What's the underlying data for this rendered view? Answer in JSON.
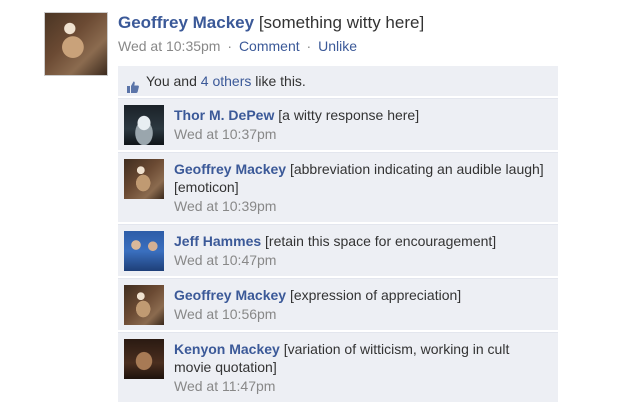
{
  "post": {
    "author": "Geoffrey Mackey",
    "text": "[something witty here]",
    "time": "Wed at 10:35pm",
    "comment_label": "Comment",
    "unlike_label": "Unlike",
    "separator": "·"
  },
  "likes": {
    "prefix": "You and ",
    "others": "4 others",
    "suffix": " like this."
  },
  "comments": [
    {
      "author": "Thor M. DePew",
      "text": "[a witty response here]",
      "time": "Wed at 10:37pm"
    },
    {
      "author": "Geoffrey Mackey",
      "text": "[abbreviation indicating an audible laugh] [emoticon]",
      "time": "Wed at 10:39pm"
    },
    {
      "author": "Jeff Hammes",
      "text": "[retain this space for encouragement]",
      "time": "Wed at 10:47pm"
    },
    {
      "author": "Geoffrey Mackey",
      "text": "[expression of appreciation]",
      "time": "Wed at 10:56pm"
    },
    {
      "author": "Kenyon Mackey",
      "text": "[variation of witticism, working in cult movie quotation]",
      "time": "Wed at 11:47pm"
    }
  ],
  "colors": {
    "link": "#3b5998",
    "comment_bg": "#edeff4",
    "meta_gray": "#888888"
  }
}
